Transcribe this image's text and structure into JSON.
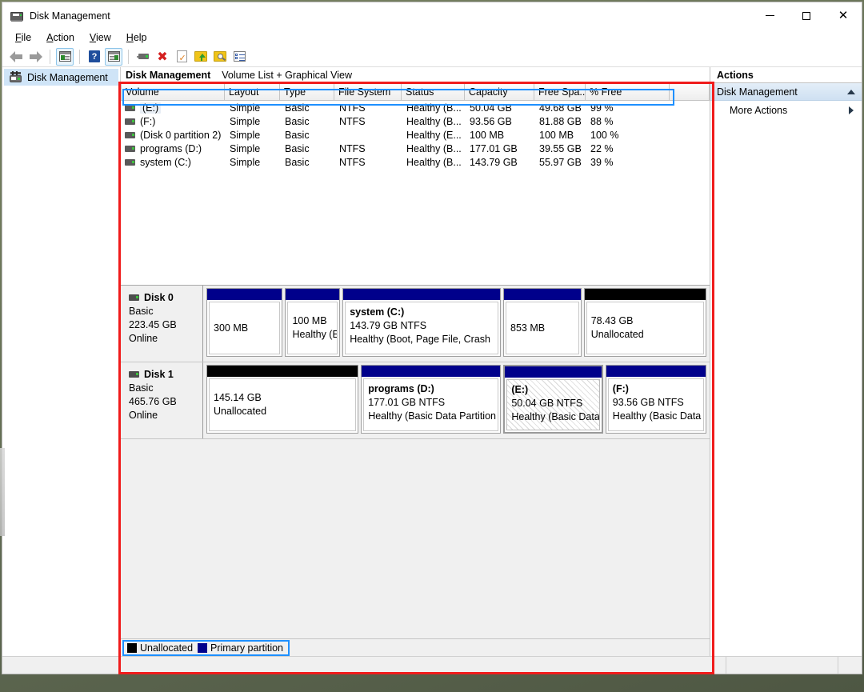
{
  "window": {
    "title": "Disk Management",
    "app_icon": "disk-drive-icon",
    "controls": {
      "minimize": "—",
      "maximize": "□",
      "close": "✕"
    }
  },
  "menubar": {
    "items": [
      {
        "label": "File",
        "mnemonic": "F"
      },
      {
        "label": "Action",
        "mnemonic": "A"
      },
      {
        "label": "View",
        "mnemonic": "V"
      },
      {
        "label": "Help",
        "mnemonic": "H"
      }
    ]
  },
  "toolbar": {
    "buttons": [
      {
        "name": "back-button",
        "icon": "left-arrow-icon",
        "tooltip": "Back"
      },
      {
        "name": "forward-button",
        "icon": "right-arrow-icon",
        "tooltip": "Forward"
      },
      {
        "name": "show-hide-tree-button",
        "icon": "console-tree-icon",
        "tooltip": "Show/Hide Console Tree"
      },
      {
        "name": "help-button",
        "icon": "question-mark-icon",
        "tooltip": "Help",
        "glyph": "?"
      },
      {
        "name": "show-hide-actions-button",
        "icon": "action-pane-icon",
        "tooltip": "Show/Hide Action Pane"
      },
      {
        "name": "rescan-disks-button",
        "icon": "disk-drive-icon",
        "tooltip": "Rescan Disks"
      },
      {
        "name": "delete-button",
        "icon": "red-x-icon",
        "tooltip": "Delete",
        "glyph": "✖"
      },
      {
        "name": "properties-button",
        "icon": "document-check-icon",
        "tooltip": "Properties",
        "glyph": "✓"
      },
      {
        "name": "export-list-button",
        "icon": "folder-up-icon",
        "tooltip": "Export List"
      },
      {
        "name": "search-button",
        "icon": "folder-search-icon",
        "tooltip": "Search"
      },
      {
        "name": "detail-view-button",
        "icon": "list-view-icon",
        "tooltip": "Detail View"
      }
    ]
  },
  "tree": {
    "items": [
      {
        "label": "Disk Management",
        "icon": "disk-management-icon",
        "selected": true
      }
    ]
  },
  "pane_header": {
    "primary": "Disk Management",
    "secondary": "Volume List + Graphical View"
  },
  "volume_list": {
    "columns": [
      {
        "label": "Volume",
        "width": 130
      },
      {
        "label": "Layout",
        "width": 69
      },
      {
        "label": "Type",
        "width": 68
      },
      {
        "label": "File System",
        "width": 84
      },
      {
        "label": "Status",
        "width": 79
      },
      {
        "label": "Capacity",
        "width": 87
      },
      {
        "label": "Free Spa...",
        "width": 64
      },
      {
        "label": "% Free",
        "width": 105
      }
    ],
    "rows": [
      {
        "volume": "(E:)",
        "layout": "Simple",
        "type": "Basic",
        "filesystem": "NTFS",
        "status": "Healthy (B...",
        "capacity": "50.04 GB",
        "free": "49.68 GB",
        "percent_free": "99 %",
        "selected": true
      },
      {
        "volume": "(F:)",
        "layout": "Simple",
        "type": "Basic",
        "filesystem": "NTFS",
        "status": "Healthy (B...",
        "capacity": "93.56 GB",
        "free": "81.88 GB",
        "percent_free": "88 %",
        "selected": false
      },
      {
        "volume": "(Disk 0 partition 2)",
        "layout": "Simple",
        "type": "Basic",
        "filesystem": "",
        "status": "Healthy (E...",
        "capacity": "100 MB",
        "free": "100 MB",
        "percent_free": "100 %",
        "selected": false
      },
      {
        "volume": "programs (D:)",
        "layout": "Simple",
        "type": "Basic",
        "filesystem": "NTFS",
        "status": "Healthy (B...",
        "capacity": "177.01 GB",
        "free": "39.55 GB",
        "percent_free": "22 %",
        "selected": false
      },
      {
        "volume": "system (C:)",
        "layout": "Simple",
        "type": "Basic",
        "filesystem": "NTFS",
        "status": "Healthy (B...",
        "capacity": "143.79 GB",
        "free": "55.97 GB",
        "percent_free": "39 %",
        "selected": false
      }
    ]
  },
  "graphical_view": {
    "disks": [
      {
        "name": "Disk 0",
        "type": "Basic",
        "size": "223.45 GB",
        "status": "Online",
        "partitions": [
          {
            "label": "",
            "line1": "300 MB",
            "line2": "",
            "kind": "primary",
            "flex": 42,
            "selected": false
          },
          {
            "label": "",
            "line1": "100 MB",
            "line2": "Healthy (E",
            "kind": "primary",
            "flex": 30,
            "selected": false
          },
          {
            "label": "system  (C:)",
            "line1": "143.79 GB NTFS",
            "line2": "Healthy (Boot, Page File, Crash",
            "kind": "primary",
            "flex": 88,
            "selected": false
          },
          {
            "label": "",
            "line1": "853 MB",
            "line2": "",
            "kind": "primary",
            "flex": 43,
            "selected": false
          },
          {
            "label": "",
            "line1": "78.43 GB",
            "line2": "Unallocated",
            "kind": "unalloc",
            "flex": 68,
            "selected": false
          }
        ]
      },
      {
        "name": "Disk 1",
        "type": "Basic",
        "size": "465.76 GB",
        "status": "Online",
        "partitions": [
          {
            "label": "",
            "line1": "145.14 GB",
            "line2": "Unallocated",
            "kind": "unalloc",
            "flex": 100,
            "selected": false
          },
          {
            "label": "programs  (D:)",
            "line1": "177.01 GB NTFS",
            "line2": "Healthy (Basic Data Partition",
            "kind": "primary",
            "flex": 92,
            "selected": false
          },
          {
            "label": "(E:)",
            "line1": "50.04 GB NTFS",
            "line2": "Healthy (Basic Data Parti",
            "kind": "primary",
            "flex": 64,
            "selected": true
          },
          {
            "label": "(F:)",
            "line1": "93.56 GB NTFS",
            "line2": "Healthy (Basic Data Partitio",
            "kind": "primary",
            "flex": 66,
            "selected": false
          }
        ]
      }
    ]
  },
  "legend": {
    "items": [
      {
        "label": "Unallocated",
        "color": "#000000",
        "swatch": "black"
      },
      {
        "label": "Primary partition",
        "color": "#00008b",
        "swatch": "navy"
      }
    ]
  },
  "actions": {
    "title": "Actions",
    "group": {
      "label": "Disk Management",
      "collapse_icon": "caret-up-icon"
    },
    "items": [
      {
        "label": "More Actions",
        "submenu_icon": "caret-right-icon"
      }
    ]
  },
  "colors": {
    "primary_partition": "#00008b",
    "unallocated": "#000000",
    "annotation_red": "#f01c1c",
    "annotation_blue": "#1e90ff",
    "selection_blue": "#cfe4f7"
  }
}
